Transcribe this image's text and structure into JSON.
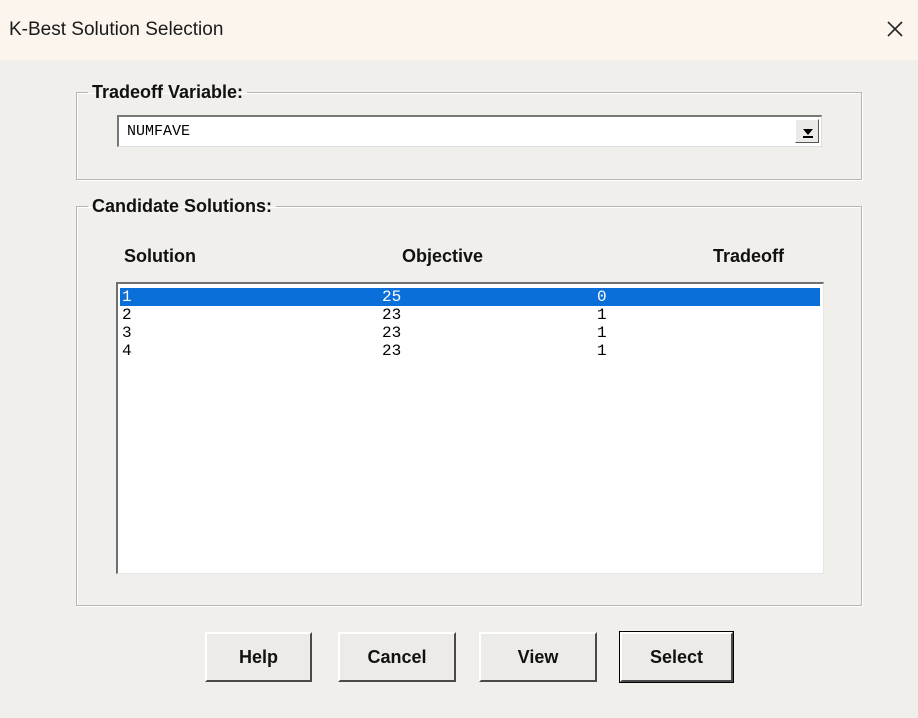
{
  "window": {
    "title": "K-Best Solution Selection",
    "close_icon": "close-icon"
  },
  "tradeoff": {
    "legend": "Tradeoff Variable:",
    "selected_value": "NUMFAVE",
    "dropdown_icon": "chevron-down-icon"
  },
  "candidates": {
    "legend": "Candidate Solutions:",
    "headers": {
      "solution": "Solution",
      "objective": "Objective",
      "tradeoff": "Tradeoff"
    },
    "rows": [
      {
        "solution": "1",
        "objective": "25",
        "tradeoff": "0",
        "selected": true
      },
      {
        "solution": "2",
        "objective": "23",
        "tradeoff": "1",
        "selected": false
      },
      {
        "solution": "3",
        "objective": "23",
        "tradeoff": "1",
        "selected": false
      },
      {
        "solution": "4",
        "objective": "23",
        "tradeoff": "1",
        "selected": false
      }
    ]
  },
  "buttons": {
    "help": "Help",
    "cancel": "Cancel",
    "view": "View",
    "select": "Select"
  },
  "colors": {
    "selection": "#0a6fd8",
    "dialog_background": "#f1efeb"
  }
}
